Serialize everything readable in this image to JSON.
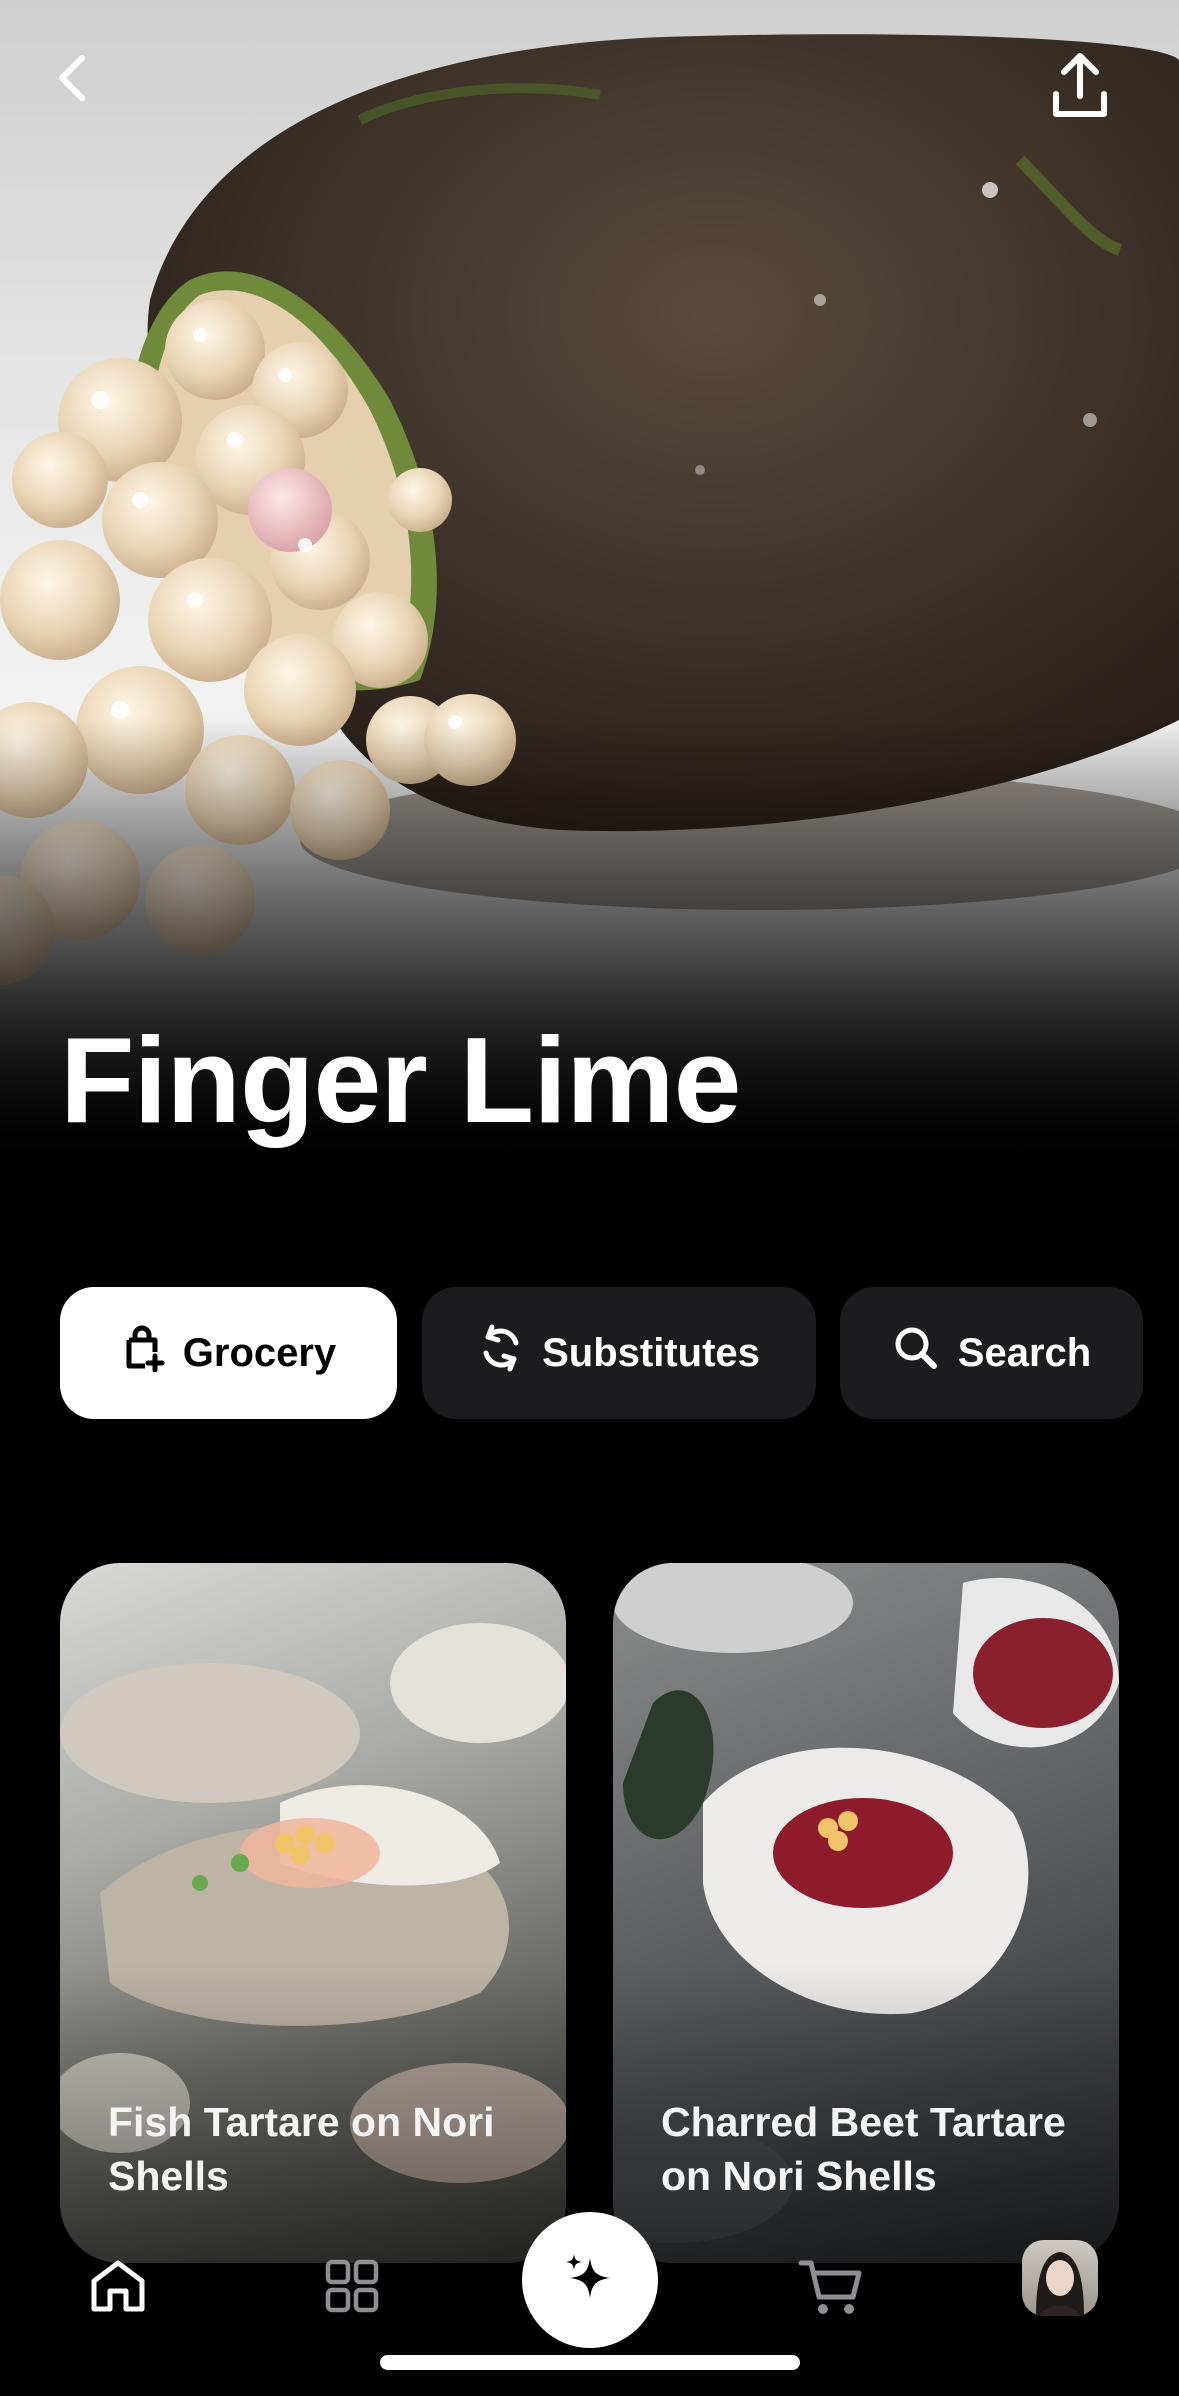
{
  "hero": {
    "title": "Finger Lime"
  },
  "actions": {
    "grocery_label": "Grocery",
    "substitutes_label": "Substitutes",
    "search_label": "Search"
  },
  "recipes": [
    {
      "title": "Fish Tartare on Nori Shells"
    },
    {
      "title": "Charred Beet Tartare on Nori Shells"
    }
  ],
  "icons": {
    "back": "chevron-left-icon",
    "share": "share-upload-icon",
    "grocery": "shopping-bag-plus-icon",
    "substitutes": "swap-arrows-icon",
    "search": "search-icon",
    "home": "home-icon",
    "grid": "grid-icon",
    "magic": "sparkles-icon",
    "cart": "cart-icon",
    "avatar": "profile-avatar"
  },
  "colors": {
    "background": "#000000",
    "chip_active_bg": "#ffffff",
    "chip_bg": "#1c1c1e",
    "text": "#ffffff"
  }
}
